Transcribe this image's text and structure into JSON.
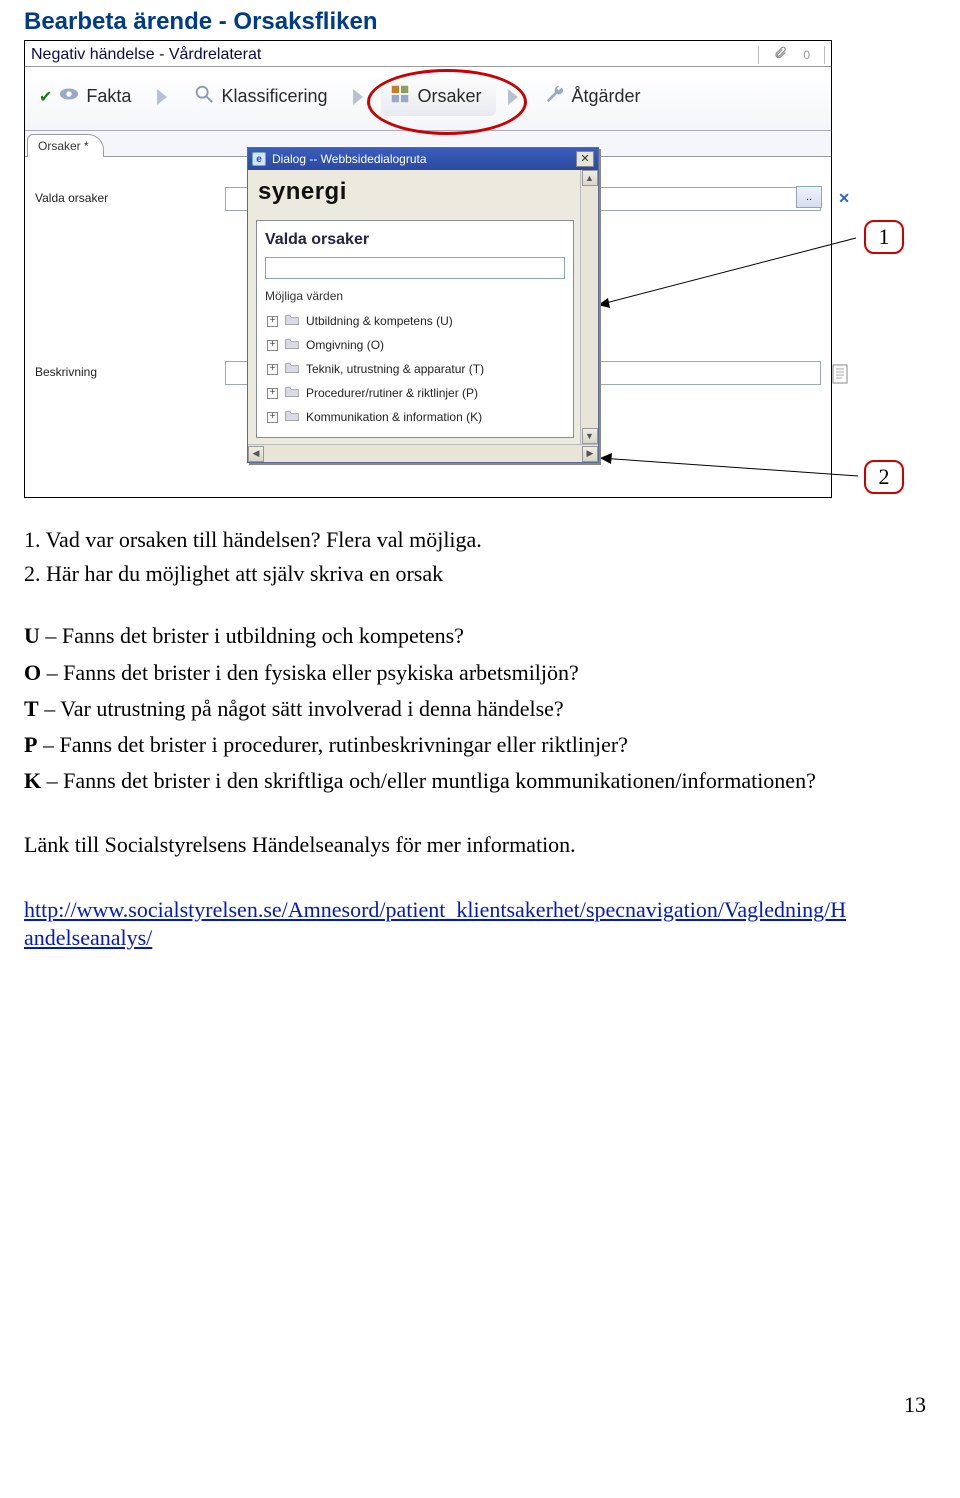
{
  "page": {
    "title": "Bearbeta ärende -  Orsaksfliken",
    "page_number": "13"
  },
  "app": {
    "title": "Negativ händelse - Vårdrelaterat",
    "attachment_count": "0",
    "main_tabs": {
      "fakta": "Fakta",
      "klassificering": "Klassificering",
      "orsaker": "Orsaker",
      "atgarder": "Åtgärder"
    },
    "sub_tab": "Orsaker *",
    "form": {
      "valda_orsaker_label": "Valda orsaker",
      "beskrivning_label": "Beskrivning",
      "dots": ".."
    }
  },
  "dialog": {
    "title": "Dialog -- Webbsidedialogruta",
    "logo": "synergi",
    "heading": "Valda orsaker",
    "subheading": "Möjliga värden",
    "tree": [
      "Utbildning & kompetens (U)",
      "Omgivning (O)",
      "Teknik, utrustning & apparatur (T)",
      "Procedurer/rutiner & riktlinjer (P)",
      "Kommunikation & information (K)"
    ]
  },
  "callouts": {
    "one": "1",
    "two": "2"
  },
  "body": {
    "item1": "Vad var orsaken till händelsen? Flera val möjliga.",
    "item2": "Här har du möjlighet att själv skriva en orsak",
    "u_bold": "U",
    "u_rest": " – Fanns det brister i utbildning och kompetens?",
    "o_bold": "O",
    "o_rest": " – Fanns det brister i den fysiska eller psykiska arbetsmiljön?",
    "t_bold": "T",
    "t_rest": " – Var utrustning på något sätt involverad i denna händelse?",
    "p_bold": "P",
    "p_rest": " – Fanns det brister i procedurer, rutinbeskrivningar eller riktlinjer?",
    "k_bold": "K",
    "k_rest": " – Fanns det brister i den skriftliga och/eller muntliga kommunikationen/informationen?",
    "link_intro": "Länk till Socialstyrelsens Händelseanalys för mer information.",
    "link_line1": "http://www.socialstyrelsen.se/Amnesord/patient_klientsakerhet/specnavigation/Vagledning/H",
    "link_line2": "andelseanalys/"
  }
}
